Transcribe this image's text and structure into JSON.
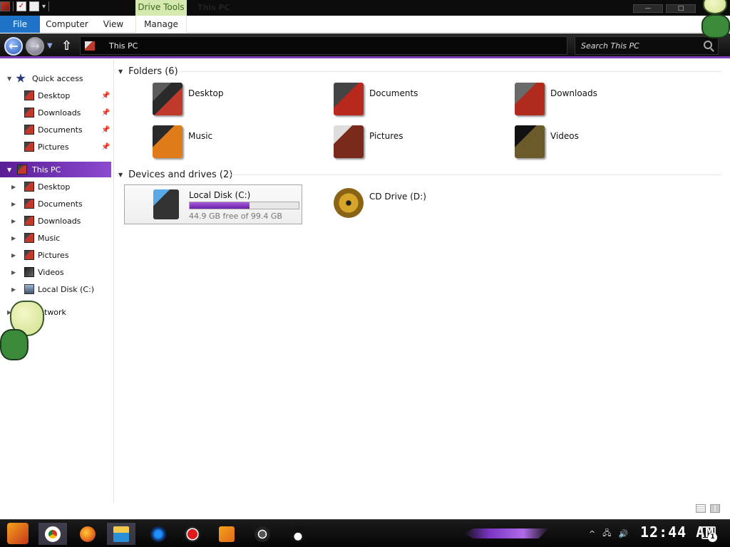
{
  "window": {
    "title": "This PC",
    "contextual_group": "Drive Tools",
    "min_glyph": "—",
    "max_glyph": "□"
  },
  "ribbon": {
    "tabs": [
      {
        "label": "File",
        "active": true
      },
      {
        "label": "Computer"
      },
      {
        "label": "View"
      },
      {
        "label": "Manage"
      }
    ]
  },
  "address": {
    "path": "This PC",
    "search_placeholder": "Search This PC"
  },
  "nav": {
    "quick_access": {
      "label": "Quick access",
      "items": [
        {
          "label": "Desktop",
          "pinned": true
        },
        {
          "label": "Downloads",
          "pinned": true
        },
        {
          "label": "Documents",
          "pinned": true
        },
        {
          "label": "Pictures",
          "pinned": true
        }
      ]
    },
    "this_pc": {
      "label": "This PC",
      "selected": true,
      "items": [
        {
          "label": "Desktop"
        },
        {
          "label": "Documents"
        },
        {
          "label": "Downloads"
        },
        {
          "label": "Music"
        },
        {
          "label": "Pictures"
        },
        {
          "label": "Videos"
        },
        {
          "label": "Local Disk (C:)"
        }
      ]
    },
    "network": {
      "label": "twork"
    }
  },
  "content": {
    "folders": {
      "header": "Folders (6)",
      "items": [
        {
          "label": "Desktop"
        },
        {
          "label": "Documents"
        },
        {
          "label": "Downloads"
        },
        {
          "label": "Music"
        },
        {
          "label": "Pictures"
        },
        {
          "label": "Videos"
        }
      ]
    },
    "drives": {
      "header": "Devices and drives (2)",
      "items": [
        {
          "label": "Local Disk (C:)",
          "free_text": "44.9 GB free of 99.4 GB",
          "used_fraction": 0.548
        },
        {
          "label": "CD Drive (D:)"
        }
      ]
    }
  },
  "taskbar": {
    "apps": [
      "start",
      "chrome",
      "firefox",
      "file-explorer",
      "media-disc",
      "recorder",
      "media-player",
      "obs",
      "tux"
    ],
    "clock": "12:44 AM",
    "notification_count": "1"
  },
  "colors": {
    "accent_purple": "#7d3fb8",
    "file_tab_blue": "#1e73c9",
    "drive_tools_green": "#d5e8b0"
  }
}
